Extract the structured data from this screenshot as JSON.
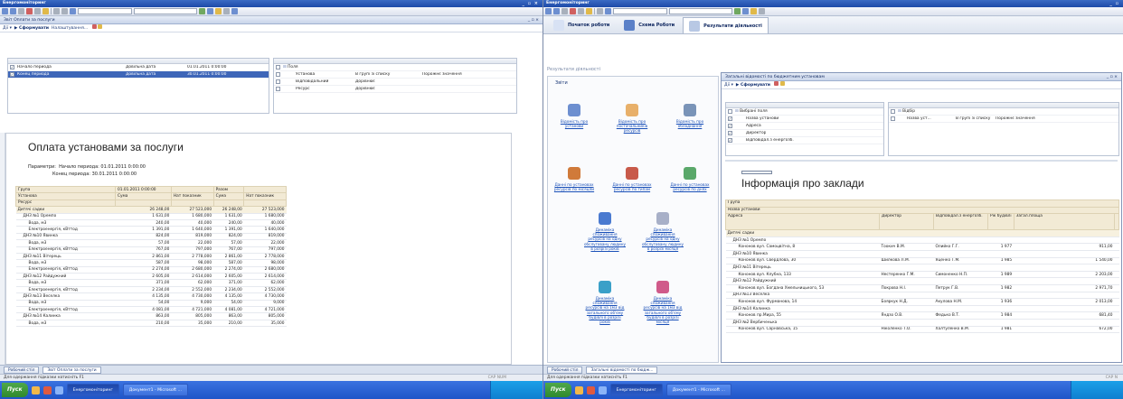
{
  "left": {
    "window_title": "Енергомоніторинг",
    "window_controls": "_ ▫ ×",
    "inner_title": "Звіт Оплати за послуги",
    "inner_controls": "_ ▫ ×",
    "cmd_menu": "Дії ▾",
    "cmd_generate": "▶ Сформувати",
    "cmd_settings": "Налаштування...",
    "params_rows": [
      {
        "name": "Начало периода",
        "type": "Довільна дата",
        "value": "01.01.2011 0:00:00",
        "selected": false
      },
      {
        "name": "Конец периода",
        "type": "Довільна дата",
        "value": "30.01.2011 0:00:00",
        "selected": true
      }
    ],
    "fields_root": "Поля",
    "fields_rows": [
      {
        "name": "Установа",
        "kind": "В групі зі списку",
        "extra": "Порожнє значення"
      },
      {
        "name": "Відповідальний",
        "kind": "Дорівнює",
        "extra": ""
      },
      {
        "name": "Ресурс",
        "kind": "Дорівнює",
        "extra": ""
      }
    ],
    "report_title": "Оплата установами за послуги",
    "params_label": "Параметри:",
    "params_line1": "Начало периода: 01.01.2011 0:00:00",
    "params_line2": "Конец периода: 30.01.2011 0:00:00",
    "table_head": [
      [
        "Група",
        "01.01.2011 0:00:00",
        "",
        "Разом",
        ""
      ],
      [
        "Установа",
        "Сума",
        "Нат показник",
        "Сума",
        "Нат показник"
      ],
      [
        "Ресурс",
        "",
        "",
        "",
        ""
      ]
    ],
    "table_rows": [
      {
        "label": "Дитячі садки",
        "v": [
          "26 248,00",
          "27 523,000",
          "26 248,00",
          "27 523,000"
        ],
        "grp": true,
        "indent": 0
      },
      {
        "label": "ДНЗ №1 Оремпо",
        "v": [
          "1 631,00",
          "1 680,000",
          "1 631,00",
          "1 680,000"
        ],
        "grp": false,
        "indent": 1
      },
      {
        "label": "Вода, м3",
        "v": [
          "240,00",
          "40,000",
          "240,00",
          "40,000"
        ],
        "grp": false,
        "indent": 2
      },
      {
        "label": "Електроенергія, кВттод",
        "v": [
          "1 391,00",
          "1 640,000",
          "1 391,00",
          "1 640,000"
        ],
        "grp": false,
        "indent": 2
      },
      {
        "label": "ДНЗ №10 Явинка",
        "v": [
          "824,00",
          "819,000",
          "824,00",
          "819,000"
        ],
        "grp": false,
        "indent": 1
      },
      {
        "label": "Вода, м3",
        "v": [
          "57,00",
          "22,000",
          "57,00",
          "22,000"
        ],
        "grp": false,
        "indent": 2
      },
      {
        "label": "Електроенергія, кВттод",
        "v": [
          "767,00",
          "797,000",
          "767,00",
          "797,000"
        ],
        "grp": false,
        "indent": 2
      },
      {
        "label": "ДНЗ №11 Вітерець",
        "v": [
          "2 861,00",
          "2 778,000",
          "2 861,00",
          "2 778,000"
        ],
        "grp": false,
        "indent": 1
      },
      {
        "label": "Вода, м3",
        "v": [
          "587,00",
          "98,000",
          "587,00",
          "98,000"
        ],
        "grp": false,
        "indent": 2
      },
      {
        "label": "Електроенергія, кВттод",
        "v": [
          "2 274,00",
          "2 680,000",
          "2 274,00",
          "2 680,000"
        ],
        "grp": false,
        "indent": 2
      },
      {
        "label": "ДНЗ №12 Райдужний",
        "v": [
          "2 605,00",
          "2 614,000",
          "2 605,00",
          "2 614,000"
        ],
        "grp": false,
        "indent": 1
      },
      {
        "label": "Вода, м3",
        "v": [
          "371,00",
          "62,000",
          "371,00",
          "62,000"
        ],
        "grp": false,
        "indent": 2
      },
      {
        "label": "Електроенергія, кВттод",
        "v": [
          "2 234,00",
          "2 552,000",
          "2 234,00",
          "2 552,000"
        ],
        "grp": false,
        "indent": 2
      },
      {
        "label": "ДНЗ №13 Веселка",
        "v": [
          "4 135,00",
          "4 730,000",
          "4 135,00",
          "4 730,000"
        ],
        "grp": false,
        "indent": 1
      },
      {
        "label": "Вода, м3",
        "v": [
          "54,00",
          "9,000",
          "54,00",
          "9,000"
        ],
        "grp": false,
        "indent": 2
      },
      {
        "label": "Електроенергія, кВттод",
        "v": [
          "4 081,00",
          "4 721,000",
          "4 081,00",
          "4 721,000"
        ],
        "grp": false,
        "indent": 2
      },
      {
        "label": "ДНЗ №14 Калинка",
        "v": [
          "863,00",
          "805,000",
          "863,00",
          "805,000"
        ],
        "grp": false,
        "indent": 1
      },
      {
        "label": "Вода, м3",
        "v": [
          "210,00",
          "35,000",
          "210,00",
          "35,000"
        ],
        "grp": false,
        "indent": 2
      }
    ],
    "wintab_desktop": "Робочий стіл",
    "wintab_report": "Звіт Оплати за послуги",
    "status_hint": "Для одержання підказки натисніть F1",
    "status_caps": "CAP  NUM"
  },
  "right": {
    "window_title": "Енергомоніторинг",
    "tabs": [
      "Початок роботи",
      "Схема Роботи",
      "Результати діяльності"
    ],
    "section_title": "Результати діяльності",
    "reports_label": "Звіти",
    "report_links": [
      "Відомість про установи",
      "Відомість про постачальників ресурсів",
      "Відомість про обладнання",
      "Данні по установах ресурсів по місяцям",
      "Данні по установах ресурсів по типам",
      "Данні по установах ресурсів по днях",
      "Динаміка споживання ресурсів на одну обслуговану людину в розрізі років",
      "Динаміка споживання ресурсів на одну обслуговану людину в розрізі місяця",
      "Динаміка споживання ресурсів на 1м3 від загального об'єму будівлі в розрізі років",
      "Динаміка споживання ресурсів на 1м3 від загального об'єму будівлі в розрізі місяця"
    ],
    "inner_title": "Загальні відомості по бюджетним установам",
    "inner_controls": "_ ▫ ×",
    "cmd_menu": "Дії ▾",
    "cmd_generate": "▶ Сформувати",
    "sel_root": "Вибрані поля",
    "sel_fields": [
      "Назва установи",
      "Адреса",
      "Директор",
      "Відповідал.з енергозб."
    ],
    "filter_root": "Відбір",
    "filter_row": {
      "name": "Назва уст...",
      "kind": "В групі зі списку",
      "extra": "Порожнє значення"
    },
    "info_title": "Інформація про заклади",
    "info_head": [
      "Група",
      "Назва установи",
      "Адреса",
      "Директор",
      "Відповідал.з енергозб.",
      "Рік будівлі",
      "Загал.площа"
    ],
    "info_rows": [
      {
        "a": "Дитячі садки",
        "d": "",
        "r": "",
        "y": "",
        "s": "",
        "indent": 0
      },
      {
        "a": "ДНЗ №1 Оремпо",
        "d": "",
        "r": "",
        "y": "",
        "s": "",
        "indent": 1
      },
      {
        "a": "Кононов вул. Самоцвітна, 8",
        "d": "Тоокич В.М.",
        "r": "Олийко Г.Г.",
        "y": "1 977",
        "s": "911,00",
        "indent": 2
      },
      {
        "a": "ДНЗ №10 Явинка",
        "d": "",
        "r": "",
        "y": "",
        "s": "",
        "indent": 1
      },
      {
        "a": "Кононов вул. Свердлова, 30",
        "d": "Шилкова Л.М.",
        "r": "Яценко Т.М.",
        "y": "1 985",
        "s": "1 540,00",
        "indent": 2
      },
      {
        "a": "ДНЗ №11 Вітерець",
        "d": "",
        "r": "",
        "y": "",
        "s": "",
        "indent": 1
      },
      {
        "a": "Кононов вул. Клубна, 133",
        "d": "Нестеренко Г.М.",
        "r": "Симоненко Н.П.",
        "y": "1 989",
        "s": "2 203,00",
        "indent": 2
      },
      {
        "a": "ДНЗ №12 Райдужний",
        "d": "",
        "r": "",
        "y": "",
        "s": "",
        "indent": 1
      },
      {
        "a": "Кононов вул. Богдана Хмельницького, 53",
        "d": "Покрова Н.І.",
        "r": "Петрук Г.В.",
        "y": "1 982",
        "s": "2 971,70",
        "indent": 2
      },
      {
        "a": "ДНЗ №13 Веселка",
        "d": "",
        "r": "",
        "y": "",
        "s": "",
        "indent": 1
      },
      {
        "a": "Кононов вул. Фурманова, 14",
        "d": "Бояркук Н.Д.",
        "r": "Акулова Н.М.",
        "y": "1 936",
        "s": "2 013,00",
        "indent": 2
      },
      {
        "a": "ДНЗ №14 Калинка",
        "d": "",
        "r": "",
        "y": "",
        "s": "",
        "indent": 1
      },
      {
        "a": "Кононов пр.Мира, 55",
        "d": "Яндзо О.В.",
        "r": "Федько В.Т.",
        "y": "1 984",
        "s": "681,40",
        "indent": 2
      },
      {
        "a": "ДНЗ №2 Вербиченька",
        "d": "",
        "r": "",
        "y": "",
        "s": "",
        "indent": 1
      },
      {
        "a": "Кононов вул. Сарнавська, 15",
        "d": "Ніколенко Т.О.",
        "r": "Халтуленко В.М.",
        "y": "1 981",
        "s": "672,00",
        "indent": 2
      }
    ],
    "wintab_desktop": "Робочий стіл",
    "wintab_report": "Загальні відомості по бюдж...",
    "status_hint": "Для одержання підказки натисніть F1",
    "status_caps": "CAP  N"
  },
  "taskbar": {
    "start": "Пуск",
    "left_task1": "Енергомоніторинг",
    "left_task2": "Документ1 - Microsoft ...",
    "right_task1": "Енергомоніторинг",
    "right_task2": "Документ1 - Microsoft ..."
  }
}
